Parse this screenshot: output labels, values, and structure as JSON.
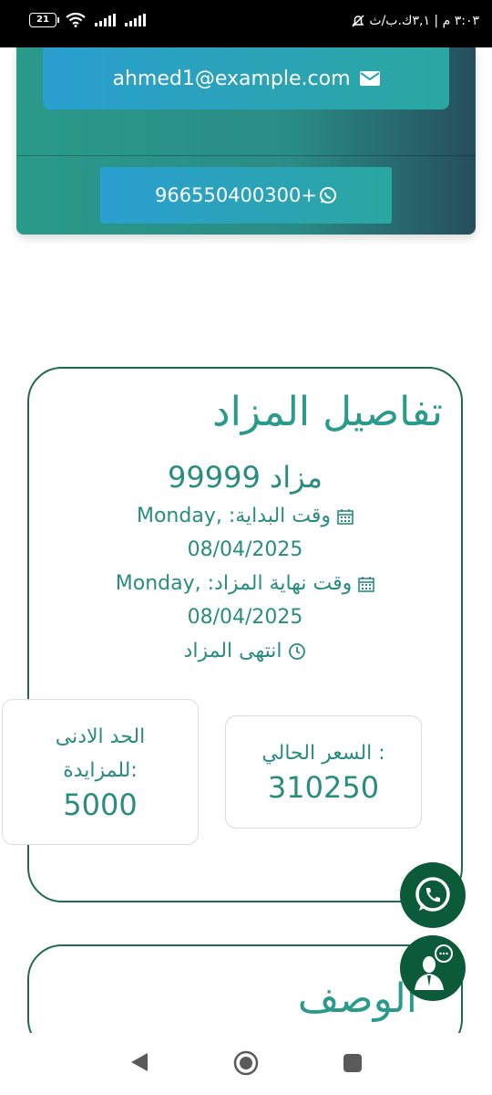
{
  "status_bar": {
    "time_info": "٣:٠٣ م | ٣,١ك.ب/ث",
    "battery": "21"
  },
  "contact": {
    "email": "ahmed1@example.com",
    "phone": "966550400300+"
  },
  "auction": {
    "section_title": "تفاصيل المزاد",
    "name": "مزاد 99999",
    "start_line1": "وقت البداية: ,Monday",
    "start_line2": "08/04/2025",
    "end_line1": "وقت نهاية المزاد: ,Monday",
    "end_line2": "08/04/2025",
    "status": "انتهى المزاد",
    "current_price_label": "السعر الحالي :",
    "current_price_value": "310250",
    "min_bid_label_line1": "الحد الادنى",
    "min_bid_label_line2": "للمزايدة:",
    "min_bid_value": "5000"
  },
  "description": {
    "title": "الوصف"
  },
  "colors": {
    "accent": "#2a9a8a",
    "dark_green": "#0b5a3a",
    "button_blue": "#2a9fd1"
  },
  "icons": [
    "envelope-icon",
    "whatsapp-icon",
    "calendar-icon",
    "clock-icon",
    "support-agent-icon",
    "back-icon",
    "home-icon",
    "recents-icon"
  ]
}
